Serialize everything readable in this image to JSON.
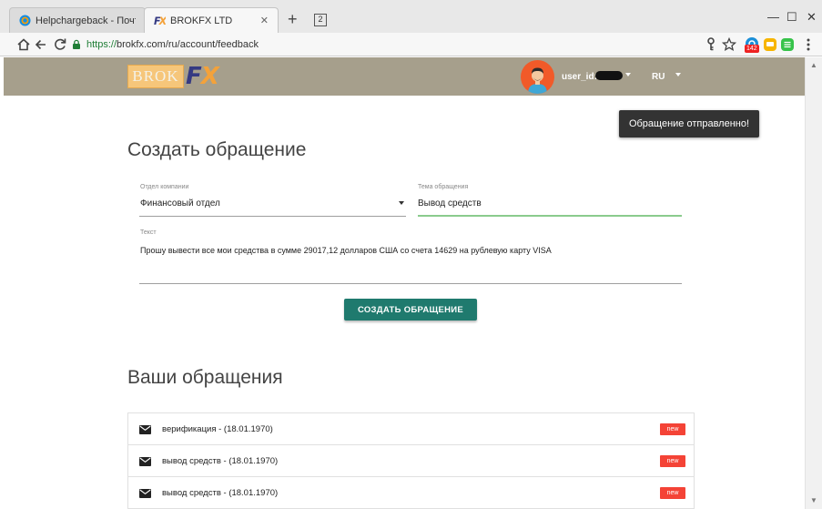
{
  "browser": {
    "tabs": [
      {
        "title": "Helpchargeback - Почта Mail.Ru",
        "active": false
      },
      {
        "title": "BROKFX LTD",
        "active": true
      }
    ],
    "new_tab_label": "+",
    "tab_count": "2",
    "window_controls": {
      "minimize": "—",
      "maximize": "☐",
      "close": "✕"
    },
    "url_scheme": "https://",
    "url_rest": "brokfx.com/ru/account/feedback",
    "extension_badge": "142"
  },
  "header": {
    "logo_brok": "BROK",
    "logo_f": "F",
    "logo_x": "X",
    "user_label": "user_id:",
    "lang": "RU"
  },
  "toast": {
    "message": "Обращение отправленно!"
  },
  "form": {
    "title": "Создать обращение",
    "department_label": "Отдел компании",
    "department_value": "Финансовый отдел",
    "subject_label": "Тема обращения",
    "subject_value": "Вывод средств",
    "text_label": "Текст",
    "text_value": "Прошу вывести все мои средства в сумме 29017,12 долларов США со счета 14629 на рублевую карту  VISA",
    "submit_label": "СОЗДАТЬ ОБРАЩЕНИЕ"
  },
  "requests": {
    "title": "Ваши обращения",
    "items": [
      {
        "text": "верификация - (18.01.1970)",
        "badge": "new"
      },
      {
        "text": "вывод средств - (18.01.1970)",
        "badge": "new"
      },
      {
        "text": "вывод средств - (18.01.1970)",
        "badge": "new"
      }
    ]
  },
  "colors": {
    "header_bg": "#a69f8c",
    "primary_button": "#1f7a6e",
    "badge_new": "#f44336",
    "focus_underline": "#4caf50",
    "toast_bg": "#333333"
  }
}
